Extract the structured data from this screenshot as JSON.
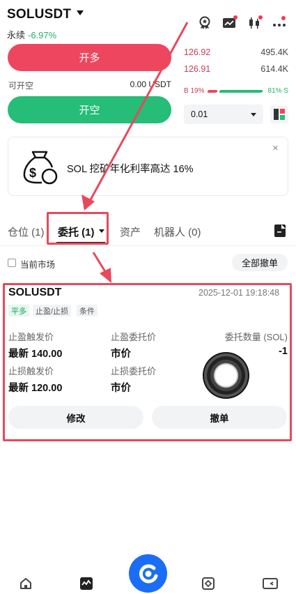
{
  "header": {
    "symbol": "SOLUSDT",
    "perp_label": "永续",
    "change": "-6.97%"
  },
  "trade": {
    "long_label": "开多",
    "short_label": "开空",
    "available_label": "可开空",
    "available_value": "0.00 USDT"
  },
  "orderbook": {
    "rows": [
      {
        "price": "126.92",
        "qty": "495.4K"
      },
      {
        "price": "126.91",
        "qty": "614.4K"
      }
    ],
    "buy_ratio": "B 19%",
    "sell_ratio": "81% S",
    "precision": "0.01"
  },
  "banner": {
    "text": "SOL 挖矿年化利率高达 16%",
    "close": "×"
  },
  "tabs": [
    {
      "label": "仓位 (1)"
    },
    {
      "label": "委托 (1)"
    },
    {
      "label": "资产"
    },
    {
      "label": "机器人 (0)"
    }
  ],
  "filter": {
    "current_market": "当前市场",
    "cancel_all": "全部撤单"
  },
  "order": {
    "symbol": "SOLUSDT",
    "time": "2025-12-01 19:18:48",
    "tags": [
      "平多",
      "止盈/止损",
      "条件"
    ],
    "tp_trigger_label": "止盈触发价",
    "tp_trigger_value": "最新 140.00",
    "tp_order_label": "止盈委托价",
    "tp_order_value": "市价",
    "qty_label": "委托数量 (SOL)",
    "qty_value": "-1",
    "sl_trigger_label": "止损触发价",
    "sl_trigger_value": "最新 120.00",
    "sl_order_label": "止损委托价",
    "sl_order_value": "市价",
    "modify": "修改",
    "cancel": "撤单"
  },
  "colors": {
    "long": "#ef4660",
    "short": "#25bd78",
    "accent": "#1a6ef5",
    "highlight": "#e8495a"
  },
  "icons": [
    "badge-icon",
    "chart-switch-icon",
    "candlestick-icon",
    "more-icon",
    "document-icon",
    "home-icon",
    "market-icon",
    "trade-icon",
    "assets-icon",
    "wallet-icon"
  ]
}
